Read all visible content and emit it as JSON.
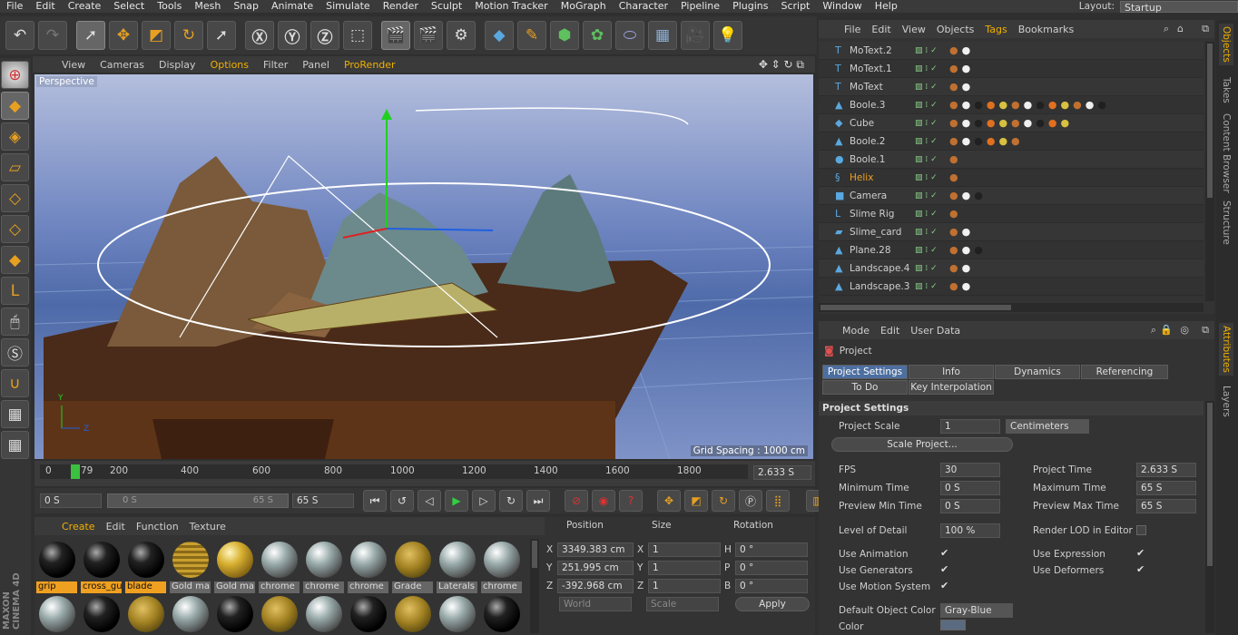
{
  "menu": [
    "File",
    "Edit",
    "Create",
    "Select",
    "Tools",
    "Mesh",
    "Snap",
    "Animate",
    "Simulate",
    "Render",
    "Sculpt",
    "Motion Tracker",
    "MoGraph",
    "Character",
    "Pipeline",
    "Plugins",
    "Script",
    "Window",
    "Help"
  ],
  "layout": {
    "label": "Layout:",
    "value": "Startup"
  },
  "viewport": {
    "menu": [
      "View",
      "Cameras",
      "Display",
      "Options",
      "Filter",
      "Panel",
      "ProRender"
    ],
    "label": "Perspective",
    "grid_spacing": "Grid Spacing : 1000 cm",
    "axis_labels": [
      "Y",
      "Z"
    ]
  },
  "timeline": {
    "ticks": [
      "0",
      "79",
      "200",
      "400",
      "600",
      "800",
      "1000",
      "1200",
      "1400",
      "1600",
      "1800"
    ],
    "current_frame": "2.633 S"
  },
  "transport": {
    "start": "0 S",
    "range_start": "0 S",
    "range_end": "65 S",
    "end": "65 S"
  },
  "materials": {
    "menu": [
      "Create",
      "Edit",
      "Function",
      "Texture"
    ],
    "items": [
      {
        "label": "grip",
        "style": "black",
        "selected": true
      },
      {
        "label": "cross_gu",
        "style": "black",
        "selected": true
      },
      {
        "label": "blade",
        "style": "black",
        "selected": true
      },
      {
        "label": "Gold ma",
        "style": "goldstripe",
        "selected": false
      },
      {
        "label": "Gold ma",
        "style": "gold",
        "selected": false
      },
      {
        "label": "chrome",
        "style": "chrome",
        "selected": false
      },
      {
        "label": "chrome",
        "style": "chrome",
        "selected": false
      },
      {
        "label": "chrome",
        "style": "chrome",
        "selected": false
      },
      {
        "label": "Grade",
        "style": "goldtex",
        "selected": false
      },
      {
        "label": "Laterals",
        "style": "chrome",
        "selected": false
      },
      {
        "label": "chrome",
        "style": "chrome",
        "selected": false
      }
    ]
  },
  "coords": {
    "headers": [
      "Position",
      "Size",
      "Rotation"
    ],
    "rows": [
      {
        "axis": "X",
        "pos": "3349.383 cm",
        "size_axis": "X",
        "size": "1",
        "rot_axis": "H",
        "rot": "0 °"
      },
      {
        "axis": "Y",
        "pos": "251.995 cm",
        "size_axis": "Y",
        "size": "1",
        "rot_axis": "P",
        "rot": "0 °"
      },
      {
        "axis": "Z",
        "pos": "-392.968 cm",
        "size_axis": "Z",
        "size": "1",
        "rot_axis": "B",
        "rot": "0 °"
      }
    ],
    "mode": "World",
    "scale": "Scale",
    "apply": "Apply"
  },
  "objects": {
    "menu": [
      "File",
      "Edit",
      "View",
      "Objects",
      "Tags",
      "Bookmarks"
    ],
    "rows": [
      {
        "name": "MoText.2",
        "icon": "T",
        "color": "#cfcfcf"
      },
      {
        "name": "MoText.1",
        "icon": "T",
        "color": "#cfcfcf"
      },
      {
        "name": "MoText",
        "icon": "T",
        "color": "#cfcfcf"
      },
      {
        "name": "Boole.3",
        "icon": "▲",
        "color": "#cfcfcf"
      },
      {
        "name": "Cube",
        "icon": "◆",
        "color": "#cfcfcf"
      },
      {
        "name": "Boole.2",
        "icon": "▲",
        "color": "#cfcfcf"
      },
      {
        "name": "Boole.1",
        "icon": "●",
        "color": "#cfcfcf"
      },
      {
        "name": "Helix",
        "icon": "§",
        "color": "#f0a020"
      },
      {
        "name": "Camera",
        "icon": "■",
        "color": "#cfcfcf"
      },
      {
        "name": "Slime Rig",
        "icon": "L",
        "color": "#cfcfcf"
      },
      {
        "name": "Slime_card",
        "icon": "▰",
        "color": "#cfcfcf"
      },
      {
        "name": "Plane.28",
        "icon": "▲",
        "color": "#cfcfcf"
      },
      {
        "name": "Landscape.4",
        "icon": "▲",
        "color": "#cfcfcf"
      },
      {
        "name": "Landscape.3",
        "icon": "▲",
        "color": "#cfcfcf"
      }
    ]
  },
  "attributes": {
    "menu": [
      "Mode",
      "Edit",
      "User Data"
    ],
    "title": "Project",
    "tabs": [
      "Project Settings",
      "Info",
      "Dynamics",
      "Referencing",
      "To Do",
      "Key Interpolation"
    ],
    "section": "Project Settings",
    "project_scale": {
      "label": "Project Scale",
      "value": "1",
      "unit": "Centimeters"
    },
    "scale_button": "Scale Project...",
    "fields": {
      "fps": {
        "label": "FPS",
        "value": "30"
      },
      "project_time": {
        "label": "Project Time",
        "value": "2.633 S"
      },
      "min_time": {
        "label": "Minimum Time",
        "value": "0 S"
      },
      "max_time": {
        "label": "Maximum Time",
        "value": "65 S"
      },
      "prev_min": {
        "label": "Preview Min Time",
        "value": "0 S"
      },
      "prev_max": {
        "label": "Preview Max Time",
        "value": "65 S"
      },
      "lod": {
        "label": "Level of Detail",
        "value": "100 %"
      },
      "render_lod": {
        "label": "Render LOD in Editor"
      }
    },
    "checks": [
      {
        "label": "Use Animation",
        "checked": true
      },
      {
        "label": "Use Expression",
        "checked": true
      },
      {
        "label": "Use Generators",
        "checked": true
      },
      {
        "label": "Use Deformers",
        "checked": true
      },
      {
        "label": "Use Motion System",
        "checked": true
      }
    ],
    "default_color": {
      "label": "Default Object Color",
      "value": "Gray-Blue"
    },
    "color_label": "Color"
  },
  "side_tabs": [
    "Objects",
    "Takes",
    "Content Browser",
    "Structure",
    "Attributes",
    "Layers"
  ],
  "logo": "MAXON CINEMA 4D"
}
